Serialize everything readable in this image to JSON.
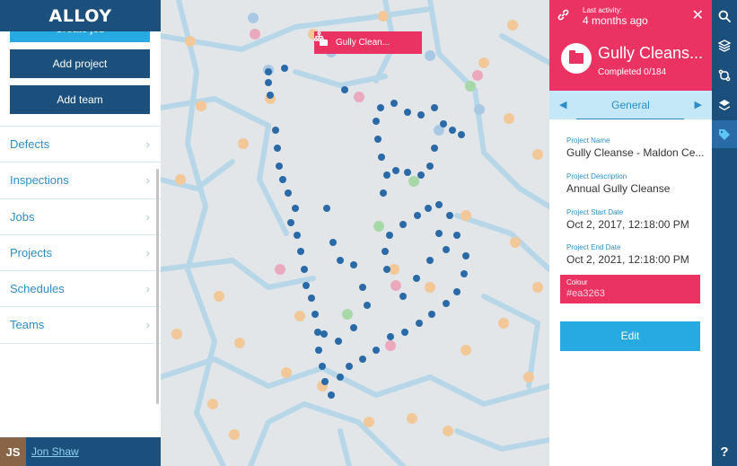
{
  "app": {
    "logo": "ALLOY"
  },
  "sidebar": {
    "partial_button": "Create job",
    "buttons": [
      {
        "label": "Add project"
      },
      {
        "label": "Add team"
      }
    ],
    "menu": [
      {
        "label": "Defects"
      },
      {
        "label": "Inspections"
      },
      {
        "label": "Jobs"
      },
      {
        "label": "Projects"
      },
      {
        "label": "Schedules"
      },
      {
        "label": "Teams"
      }
    ],
    "chevron": "›",
    "user": {
      "initials": "JS",
      "name": "Jon Shaw"
    }
  },
  "map": {
    "label": "Gully Clean...",
    "label_icon": "folder-icon",
    "hierarchy_icon": "sitemap-icon"
  },
  "panel": {
    "activity_label": "Last activity:",
    "activity_value": "4 months ago",
    "title": "Gully Cleans...",
    "completed": "Completed 0/184",
    "tab": "General",
    "fields": [
      {
        "label": "Project Name",
        "value": "Gully Cleanse - Maldon Ce..."
      },
      {
        "label": "Project Description",
        "value": "Annual Gully Cleanse"
      },
      {
        "label": "Project Start Date",
        "value": "Oct 2, 2017, 12:18:00 PM"
      },
      {
        "label": "Project End Date",
        "value": "Oct 2, 2021, 12:18:00 PM"
      }
    ],
    "colour": {
      "label": "Colour",
      "value": "#ea3263"
    },
    "edit": "Edit"
  },
  "toolbar": {
    "tools": [
      "search-icon",
      "layers-icon",
      "route-icon",
      "stack-icon",
      "tag-icon"
    ],
    "help": "?"
  },
  "colors": {
    "brand": "#1b4f7c",
    "accent": "#ea3263",
    "action": "#27a9e1"
  }
}
